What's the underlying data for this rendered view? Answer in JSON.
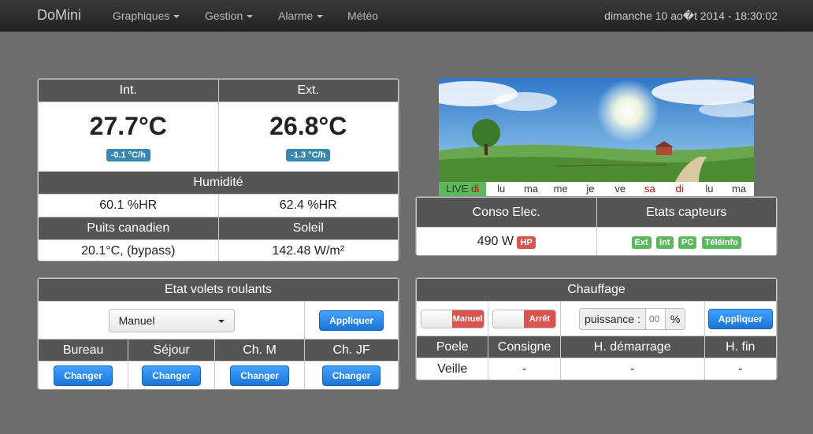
{
  "nav": {
    "brand": "DoMini",
    "items": [
      "Graphiques",
      "Gestion",
      "Alarme",
      "Météo"
    ],
    "datetime": "dimanche 10 ao�t 2014 - 18:30:02"
  },
  "temps": {
    "int_label": "Int.",
    "ext_label": "Ext.",
    "int_value": "27.7°C",
    "ext_value": "26.8°C",
    "int_trend": "-0.1 °C/h",
    "ext_trend": "-1.3 °C/h",
    "humidity_label": "Humidité",
    "int_humidity": "60.1 %HR",
    "ext_humidity": "62.4 %HR",
    "puits_label": "Puits canadien",
    "soleil_label": "Soleil",
    "puits_value": "20.1°C, (bypass)",
    "soleil_value": "142.48 W/m²"
  },
  "weather": {
    "live": "LIVE",
    "live_day": "di",
    "days": [
      "lu",
      "ma",
      "me",
      "je",
      "ve",
      "sa",
      "di",
      "lu",
      "ma"
    ]
  },
  "conso": {
    "elec_label": "Conso Elec.",
    "capteurs_label": "Etats capteurs",
    "elec_value": "490 W",
    "hp_badge": "HP",
    "sensors": [
      "Ext",
      "Int",
      "PC",
      "Téléinfo"
    ]
  },
  "volets": {
    "title": "Etat volets roulants",
    "mode": "Manuel",
    "apply": "Appliquer",
    "rooms": [
      "Bureau",
      "Séjour",
      "Ch. M",
      "Ch. JF"
    ],
    "change": "Changer"
  },
  "chauffage": {
    "title": "Chauffage",
    "toggle1": "Manuel",
    "toggle2": "Arrêt",
    "puissance_label": "puissance :",
    "puissance_placeholder": "00",
    "percent": "%",
    "apply": "Appliquer",
    "headers": [
      "Poele",
      "Consigne",
      "H. démarrage",
      "H. fin"
    ],
    "values": [
      "Veille",
      "-",
      "-",
      "-"
    ]
  },
  "colors": {
    "navbar": "#222222",
    "header": "#555555",
    "accent": "#1b74d6",
    "green": "#5cb85c",
    "red": "#d9534f"
  }
}
